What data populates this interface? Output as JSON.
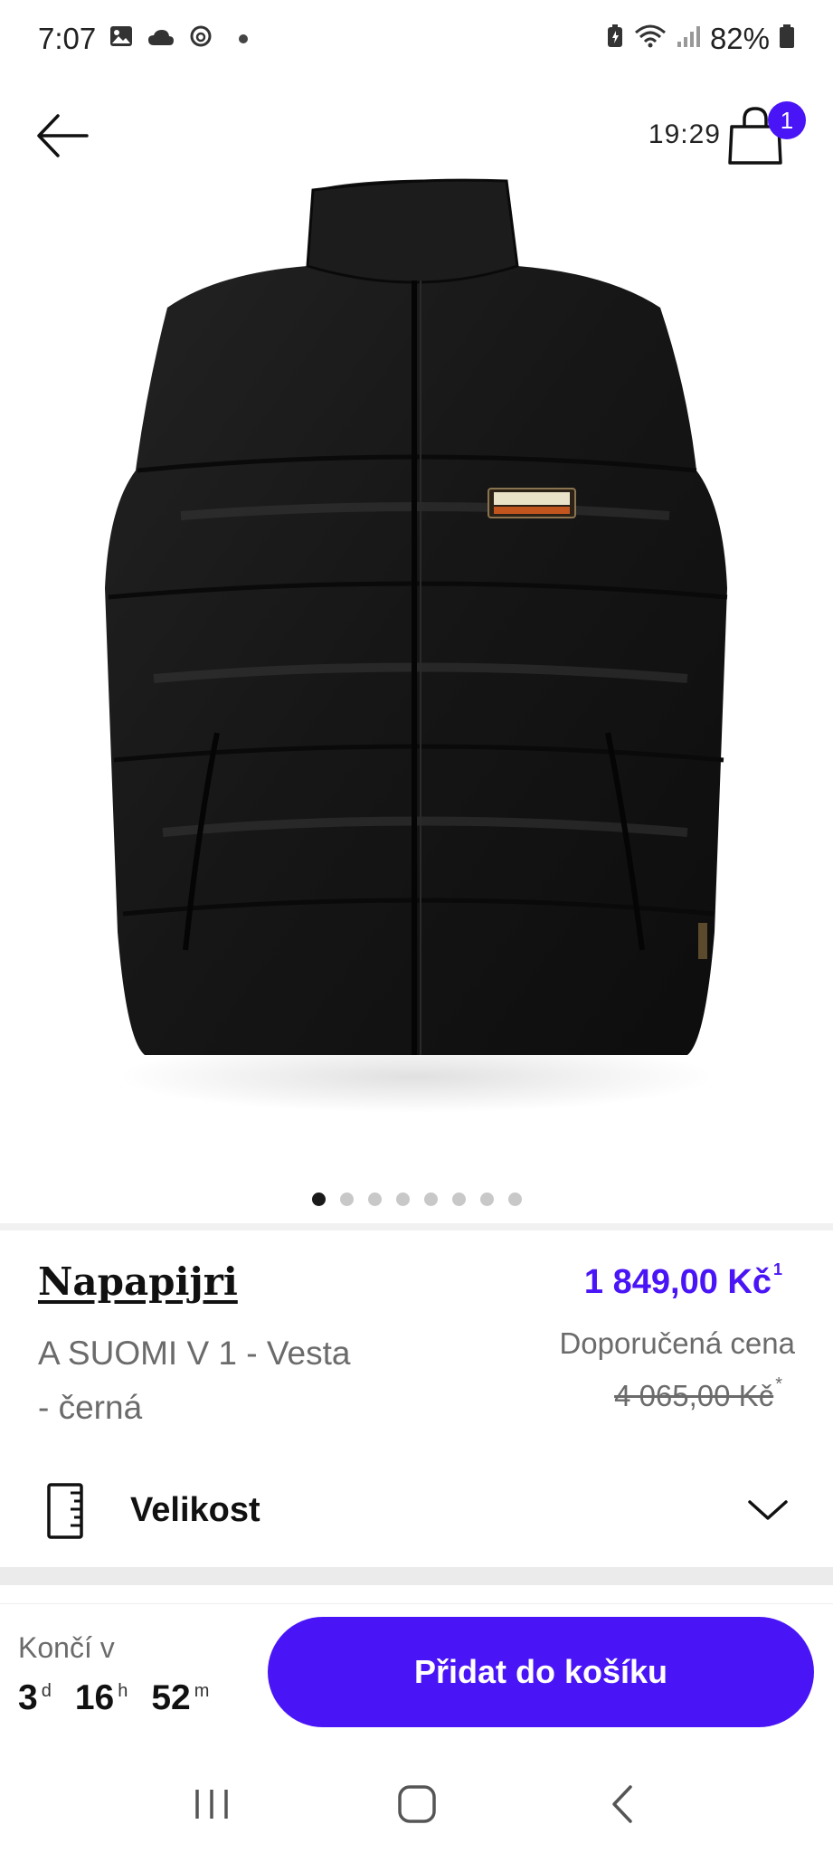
{
  "status_bar": {
    "time": "7:07",
    "battery": "82%",
    "icons": [
      "image-icon",
      "cloud-icon",
      "threads-icon",
      "notification-dot",
      "battery-saver-icon",
      "wifi-icon",
      "signal-icon",
      "battery-icon"
    ]
  },
  "header": {
    "timer": "19:29",
    "cart_count": "1",
    "back_icon": "arrow-left-icon",
    "cart_icon": "shopping-bag-icon"
  },
  "gallery": {
    "image_alt": "black-puffer-vest",
    "patch_text": "NAPAPIJRI",
    "dots_total": 8,
    "active_index": 0
  },
  "product": {
    "brand": "Napapijri",
    "name": "A SUOMI V 1 - Vesta - černá",
    "price": "1 849,00 Kč",
    "price_footnote": "1",
    "rrp_label": "Doporučená cena",
    "rrp_value": "4 065,00 Kč",
    "rrp_footnote": "*"
  },
  "size": {
    "label": "Velikost",
    "icon": "ruler-icon",
    "chevron": "chevron-down-icon"
  },
  "bottom": {
    "ends_label": "Končí v",
    "days": "3",
    "days_suffix": "d",
    "hours": "16",
    "hours_suffix": "h",
    "minutes": "52",
    "minutes_suffix": "m",
    "cta": "Přidat do košíku"
  },
  "colors": {
    "accent": "#4a15f6",
    "text_muted": "#6b6b6b",
    "text_dark": "#111111"
  }
}
